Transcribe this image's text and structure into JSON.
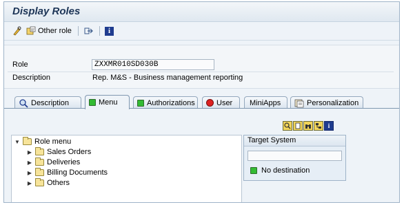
{
  "window": {
    "title": "Display Roles"
  },
  "toolbar": {
    "other_role_label": "Other role",
    "info_glyph": "i"
  },
  "header": {
    "role_label": "Role",
    "role_value": "ZXXMR010SD030B",
    "description_label": "Description",
    "description_value": "Rep. M&S - Business management reporting"
  },
  "tabs": [
    {
      "label": "Description",
      "icon": "magnifier-icon",
      "active": false
    },
    {
      "label": "Menu",
      "icon": "green-led-icon",
      "active": true
    },
    {
      "label": "Authorizations",
      "icon": "green-led-icon",
      "active": false
    },
    {
      "label": "User",
      "icon": "red-led-icon",
      "active": false
    },
    {
      "label": "MiniApps",
      "icon": "",
      "active": false
    },
    {
      "label": "Personalization",
      "icon": "personalization-icon",
      "active": false
    }
  ],
  "tree": {
    "root": "Role menu",
    "items": [
      "Sales Orders",
      "Deliveries",
      "Billing Documents",
      "Others"
    ]
  },
  "target_system": {
    "title": "Target System",
    "value": "",
    "status": "No destination",
    "status_color": "#33bb33"
  },
  "colors": {
    "title": "#1d3557",
    "frame_border": "#9eb3c8",
    "panel_bg": "#eef3f8",
    "info_blue": "#1f3c8f"
  }
}
